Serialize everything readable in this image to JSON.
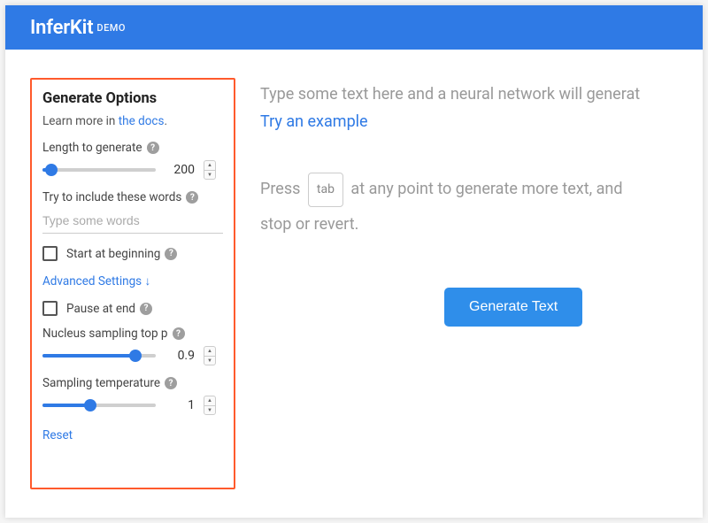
{
  "header": {
    "brand": "InferKit",
    "suffix": "DEMO"
  },
  "sidebar": {
    "title": "Generate Options",
    "learn_prefix": "Learn more in ",
    "learn_link": "the docs",
    "learn_suffix": ".",
    "length_label": "Length to generate",
    "length_value": "200",
    "length_fill_pct": "8%",
    "include_label": "Try to include these words",
    "include_placeholder": "Type some words",
    "start_label": "Start at beginning",
    "advanced_label": "Advanced Settings ↓",
    "pause_label": "Pause at end",
    "nucleus_label": "Nucleus sampling top p",
    "nucleus_value": "0.9",
    "nucleus_fill_pct": "82%",
    "temp_label": "Sampling temperature",
    "temp_value": "1",
    "temp_fill_pct": "42%",
    "reset_label": "Reset"
  },
  "main": {
    "editor_placeholder": "Type some text here and a neural network will generat",
    "try_example": "Try an example",
    "instr_prefix": "Press ",
    "tab_key": "tab",
    "instr_middle": " at any point to generate more text, and ",
    "instr_suffix": "stop or revert.",
    "generate_button": "Generate Text"
  }
}
